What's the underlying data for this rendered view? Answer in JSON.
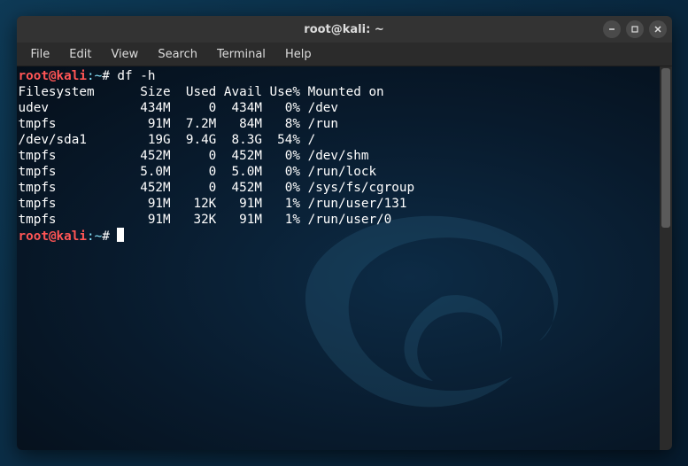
{
  "window": {
    "title": "root@kali: ~"
  },
  "menubar": {
    "items": [
      "File",
      "Edit",
      "View",
      "Search",
      "Terminal",
      "Help"
    ]
  },
  "prompt": {
    "user": "root",
    "at": "@",
    "host": "kali",
    "sep": ":",
    "path": "~",
    "sigil": "#"
  },
  "terminal": {
    "command1": "df -h",
    "header": "Filesystem      Size  Used Avail Use% Mounted on",
    "rows": [
      "udev            434M     0  434M   0% /dev",
      "tmpfs            91M  7.2M   84M   8% /run",
      "/dev/sda1        19G  9.4G  8.3G  54% /",
      "tmpfs           452M     0  452M   0% /dev/shm",
      "tmpfs           5.0M     0  5.0M   0% /run/lock",
      "tmpfs           452M     0  452M   0% /sys/fs/cgroup",
      "tmpfs            91M   12K   91M   1% /run/user/131",
      "tmpfs            91M   32K   91M   1% /run/user/0"
    ]
  },
  "chart_data": {
    "type": "table",
    "title": "df -h output",
    "columns": [
      "Filesystem",
      "Size",
      "Used",
      "Avail",
      "Use%",
      "Mounted on"
    ],
    "rows": [
      {
        "Filesystem": "udev",
        "Size": "434M",
        "Used": "0",
        "Avail": "434M",
        "Use%": "0%",
        "Mounted on": "/dev"
      },
      {
        "Filesystem": "tmpfs",
        "Size": "91M",
        "Used": "7.2M",
        "Avail": "84M",
        "Use%": "8%",
        "Mounted on": "/run"
      },
      {
        "Filesystem": "/dev/sda1",
        "Size": "19G",
        "Used": "9.4G",
        "Avail": "8.3G",
        "Use%": "54%",
        "Mounted on": "/"
      },
      {
        "Filesystem": "tmpfs",
        "Size": "452M",
        "Used": "0",
        "Avail": "452M",
        "Use%": "0%",
        "Mounted on": "/dev/shm"
      },
      {
        "Filesystem": "tmpfs",
        "Size": "5.0M",
        "Used": "0",
        "Avail": "5.0M",
        "Use%": "0%",
        "Mounted on": "/run/lock"
      },
      {
        "Filesystem": "tmpfs",
        "Size": "452M",
        "Used": "0",
        "Avail": "452M",
        "Use%": "0%",
        "Mounted on": "/sys/fs/cgroup"
      },
      {
        "Filesystem": "tmpfs",
        "Size": "91M",
        "Used": "12K",
        "Avail": "91M",
        "Use%": "1%",
        "Mounted on": "/run/user/131"
      },
      {
        "Filesystem": "tmpfs",
        "Size": "91M",
        "Used": "32K",
        "Avail": "91M",
        "Use%": "1%",
        "Mounted on": "/run/user/0"
      }
    ]
  }
}
